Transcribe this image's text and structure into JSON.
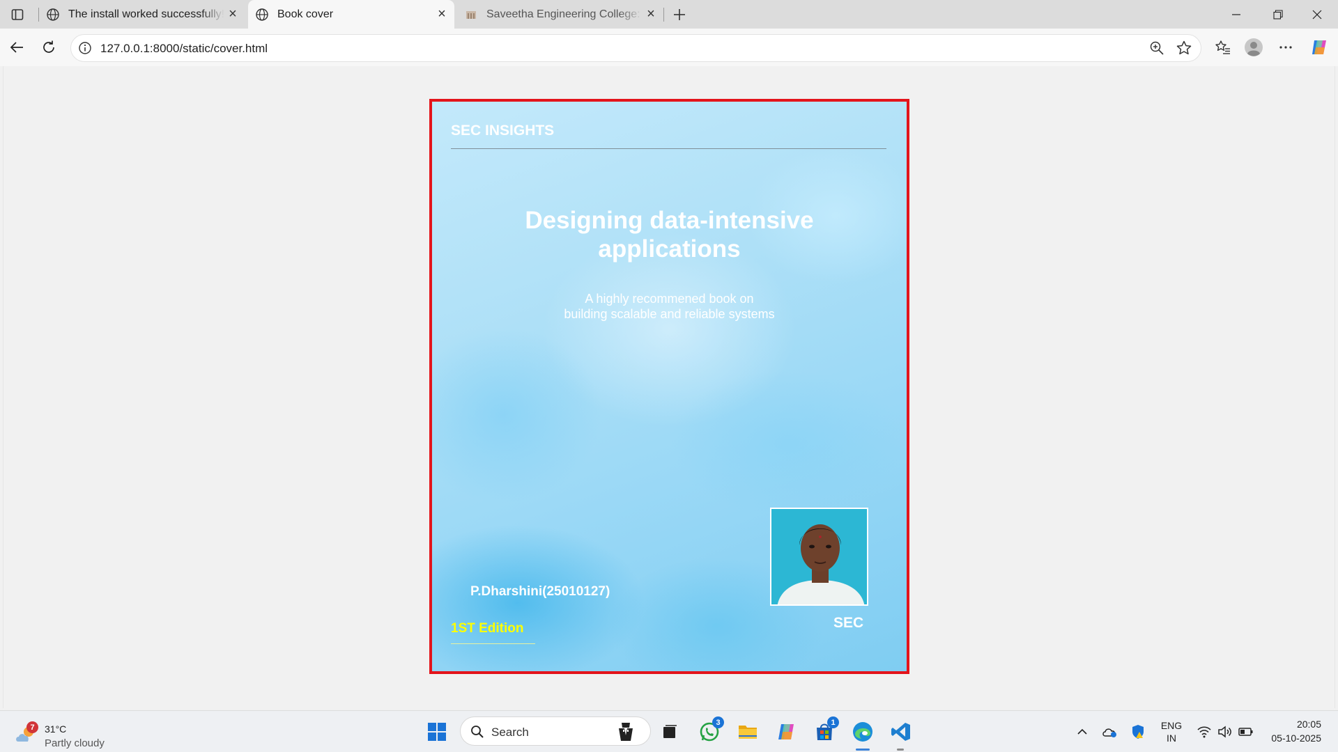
{
  "browser": {
    "tabs": [
      {
        "title": "The install worked successfully! Co",
        "state": "inactive"
      },
      {
        "title": "Book cover",
        "state": "active"
      },
      {
        "title": "Saveetha Engineering College: Lo",
        "state": "inactive"
      }
    ],
    "address_bar": {
      "url": "127.0.0.1:8000/static/cover.html"
    }
  },
  "cover": {
    "publisher": "SEC INSIGHTS",
    "title_line1": "Designing data-intensive",
    "title_line2": "applications",
    "subtitle_line1": "A highly recommened book on",
    "subtitle_line2": "building scalable and reliable systems",
    "author": "P.Dharshini(25010127)",
    "institution": "SEC",
    "edition": "1ST Edition",
    "accent_colors": {
      "border": "#e3141b",
      "edition": "#ffff00",
      "text": "#ffffff"
    }
  },
  "taskbar": {
    "weather": {
      "temperature": "31°C",
      "condition": "Partly cloudy",
      "alert_count": "7"
    },
    "search_label": "Search",
    "whatsapp_badge": "3",
    "store_badge": "1",
    "language": {
      "line1": "ENG",
      "line2": "IN"
    },
    "clock": {
      "time": "20:05",
      "date": "05-10-2025"
    }
  }
}
